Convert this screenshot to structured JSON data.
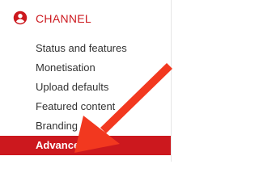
{
  "header": {
    "title": "CHANNEL",
    "icon": "account-circle-icon",
    "accent_color": "#cc181e"
  },
  "nav": {
    "items": [
      {
        "label": "Status and features",
        "active": false
      },
      {
        "label": "Monetisation",
        "active": false
      },
      {
        "label": "Upload defaults",
        "active": false
      },
      {
        "label": "Featured content",
        "active": false
      },
      {
        "label": "Branding",
        "active": false
      },
      {
        "label": "Advanced",
        "active": true
      }
    ]
  },
  "annotation": {
    "arrow_color": "#f2381f",
    "arrow_icon": "pointer-arrow-icon"
  }
}
